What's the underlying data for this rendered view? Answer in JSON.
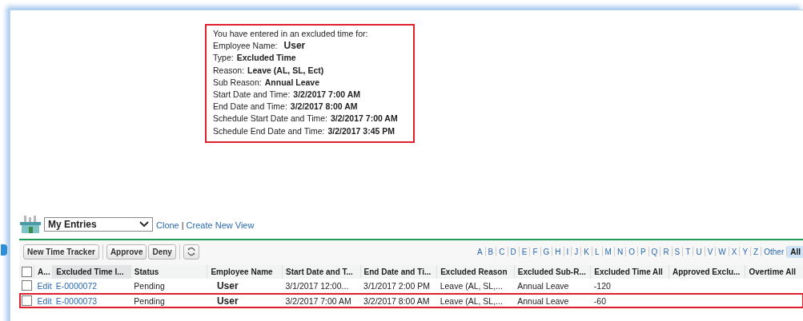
{
  "notice": {
    "heading": "You have entered in an excluded time for:",
    "highlighted": true,
    "lines": [
      {
        "label": "Employee Name:",
        "value": "User"
      },
      {
        "label": "Type:",
        "value": "Excluded Time"
      },
      {
        "label": "Reason:",
        "value": "Leave (AL, SL, Ect)"
      },
      {
        "label": "Sub Reason:",
        "value": "Annual Leave"
      },
      {
        "label": "Start Date and Time:",
        "value": "3/2/2017 7:00 AM"
      },
      {
        "label": "End Date and Time:",
        "value": "3/2/2017 8:00 AM"
      },
      {
        "label": "Schedule Start Date and Time:",
        "value": "3/2/2017 7:00 AM"
      },
      {
        "label": "Schedule End Date and Time:",
        "value": "3/2/2017 3:45 PM"
      }
    ]
  },
  "view": {
    "selected_view": "My Entries",
    "links": [
      "Clone",
      "Create New View"
    ],
    "separator": "|"
  },
  "buttons": [
    "New Time Tracker",
    "Approve",
    "Deny"
  ],
  "letters": [
    {
      "label": "A",
      "selected": false
    },
    {
      "label": "B",
      "selected": false
    },
    {
      "label": "C",
      "selected": false
    },
    {
      "label": "D",
      "selected": false
    },
    {
      "label": "E",
      "selected": false
    },
    {
      "label": "F",
      "selected": false
    },
    {
      "label": "G",
      "selected": false
    },
    {
      "label": "H",
      "selected": false
    },
    {
      "label": "I",
      "selected": false
    },
    {
      "label": "J",
      "selected": false
    },
    {
      "label": "K",
      "selected": false
    },
    {
      "label": "L",
      "selected": false
    },
    {
      "label": "M",
      "selected": false
    },
    {
      "label": "N",
      "selected": false
    },
    {
      "label": "O",
      "selected": false
    },
    {
      "label": "P",
      "selected": false
    },
    {
      "label": "Q",
      "selected": false
    },
    {
      "label": "R",
      "selected": false
    },
    {
      "label": "S",
      "selected": false
    },
    {
      "label": "T",
      "selected": false
    },
    {
      "label": "U",
      "selected": false
    },
    {
      "label": "V",
      "selected": false
    },
    {
      "label": "W",
      "selected": false
    },
    {
      "label": "X",
      "selected": false
    },
    {
      "label": "Y",
      "selected": false
    },
    {
      "label": "Z",
      "selected": false
    },
    {
      "label": "Other",
      "selected": false
    },
    {
      "label": "All",
      "selected": true
    }
  ],
  "table": {
    "select_all_checked": false,
    "columns": [
      {
        "label": "A...",
        "sorted": false
      },
      {
        "label": "Excluded Time I...",
        "sorted": true
      },
      {
        "label": "Status",
        "sorted": false
      },
      {
        "label": "Employee Name",
        "sorted": false
      },
      {
        "label": "Start Date and T...",
        "sorted": false
      },
      {
        "label": "End Date and Ti...",
        "sorted": false
      },
      {
        "label": "Excluded Reason",
        "sorted": false
      },
      {
        "label": "Excluded Sub-R...",
        "sorted": false
      },
      {
        "label": "Excluded Time All",
        "sorted": false
      },
      {
        "label": "Approved Exclu...",
        "sorted": false
      },
      {
        "label": "Overtime All",
        "sorted": false
      }
    ],
    "rows": [
      {
        "checked": false,
        "highlighted": false,
        "action": "Edit",
        "id": "E-0000072",
        "status": "Pending",
        "employee": "User",
        "start": "3/1/2017 12:00...",
        "end": "3/1/2017 2:00 PM",
        "reason": "Leave (AL, SL,...",
        "sub_reason": "Annual Leave",
        "excluded_time": "-120"
      },
      {
        "checked": false,
        "highlighted": true,
        "action": "Edit",
        "id": "E-0000073",
        "status": "Pending",
        "employee": "User",
        "start": "3/2/2017 7:00 AM",
        "end": "3/2/2017 8:00 AM",
        "reason": "Leave (AL, SL,...",
        "sub_reason": "Annual Leave",
        "excluded_time": "-60"
      }
    ]
  }
}
